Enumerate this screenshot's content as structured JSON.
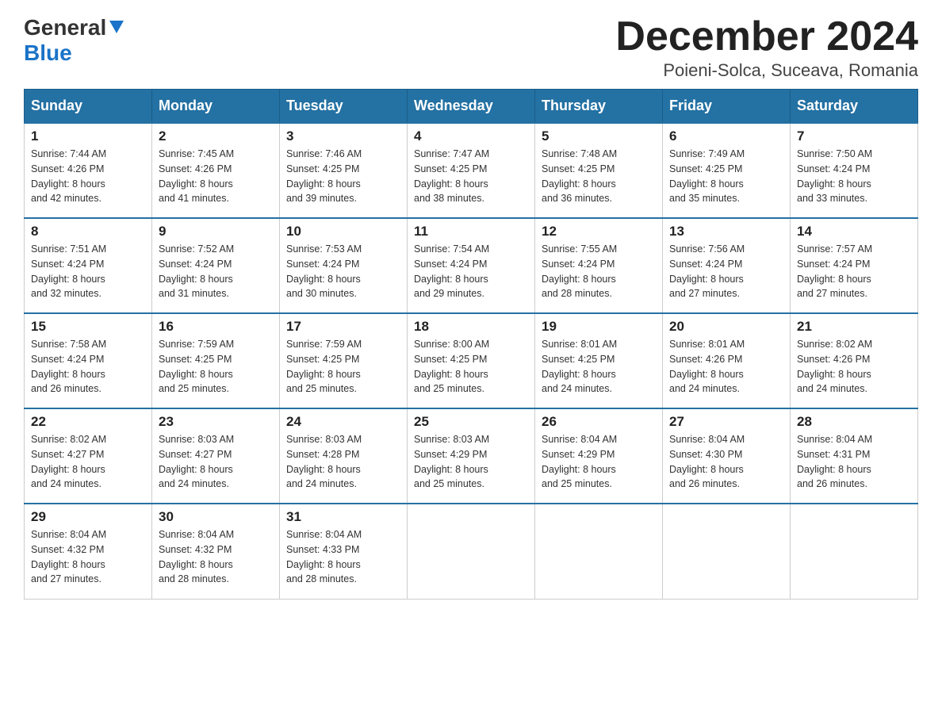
{
  "header": {
    "logo_line1": "General",
    "logo_line2": "Blue",
    "month_title": "December 2024",
    "location": "Poieni-Solca, Suceava, Romania"
  },
  "weekdays": [
    "Sunday",
    "Monday",
    "Tuesday",
    "Wednesday",
    "Thursday",
    "Friday",
    "Saturday"
  ],
  "weeks": [
    [
      {
        "day": "1",
        "sunrise": "7:44 AM",
        "sunset": "4:26 PM",
        "daylight": "8 hours and 42 minutes."
      },
      {
        "day": "2",
        "sunrise": "7:45 AM",
        "sunset": "4:26 PM",
        "daylight": "8 hours and 41 minutes."
      },
      {
        "day": "3",
        "sunrise": "7:46 AM",
        "sunset": "4:25 PM",
        "daylight": "8 hours and 39 minutes."
      },
      {
        "day": "4",
        "sunrise": "7:47 AM",
        "sunset": "4:25 PM",
        "daylight": "8 hours and 38 minutes."
      },
      {
        "day": "5",
        "sunrise": "7:48 AM",
        "sunset": "4:25 PM",
        "daylight": "8 hours and 36 minutes."
      },
      {
        "day": "6",
        "sunrise": "7:49 AM",
        "sunset": "4:25 PM",
        "daylight": "8 hours and 35 minutes."
      },
      {
        "day": "7",
        "sunrise": "7:50 AM",
        "sunset": "4:24 PM",
        "daylight": "8 hours and 33 minutes."
      }
    ],
    [
      {
        "day": "8",
        "sunrise": "7:51 AM",
        "sunset": "4:24 PM",
        "daylight": "8 hours and 32 minutes."
      },
      {
        "day": "9",
        "sunrise": "7:52 AM",
        "sunset": "4:24 PM",
        "daylight": "8 hours and 31 minutes."
      },
      {
        "day": "10",
        "sunrise": "7:53 AM",
        "sunset": "4:24 PM",
        "daylight": "8 hours and 30 minutes."
      },
      {
        "day": "11",
        "sunrise": "7:54 AM",
        "sunset": "4:24 PM",
        "daylight": "8 hours and 29 minutes."
      },
      {
        "day": "12",
        "sunrise": "7:55 AM",
        "sunset": "4:24 PM",
        "daylight": "8 hours and 28 minutes."
      },
      {
        "day": "13",
        "sunrise": "7:56 AM",
        "sunset": "4:24 PM",
        "daylight": "8 hours and 27 minutes."
      },
      {
        "day": "14",
        "sunrise": "7:57 AM",
        "sunset": "4:24 PM",
        "daylight": "8 hours and 27 minutes."
      }
    ],
    [
      {
        "day": "15",
        "sunrise": "7:58 AM",
        "sunset": "4:24 PM",
        "daylight": "8 hours and 26 minutes."
      },
      {
        "day": "16",
        "sunrise": "7:59 AM",
        "sunset": "4:25 PM",
        "daylight": "8 hours and 25 minutes."
      },
      {
        "day": "17",
        "sunrise": "7:59 AM",
        "sunset": "4:25 PM",
        "daylight": "8 hours and 25 minutes."
      },
      {
        "day": "18",
        "sunrise": "8:00 AM",
        "sunset": "4:25 PM",
        "daylight": "8 hours and 25 minutes."
      },
      {
        "day": "19",
        "sunrise": "8:01 AM",
        "sunset": "4:25 PM",
        "daylight": "8 hours and 24 minutes."
      },
      {
        "day": "20",
        "sunrise": "8:01 AM",
        "sunset": "4:26 PM",
        "daylight": "8 hours and 24 minutes."
      },
      {
        "day": "21",
        "sunrise": "8:02 AM",
        "sunset": "4:26 PM",
        "daylight": "8 hours and 24 minutes."
      }
    ],
    [
      {
        "day": "22",
        "sunrise": "8:02 AM",
        "sunset": "4:27 PM",
        "daylight": "8 hours and 24 minutes."
      },
      {
        "day": "23",
        "sunrise": "8:03 AM",
        "sunset": "4:27 PM",
        "daylight": "8 hours and 24 minutes."
      },
      {
        "day": "24",
        "sunrise": "8:03 AM",
        "sunset": "4:28 PM",
        "daylight": "8 hours and 24 minutes."
      },
      {
        "day": "25",
        "sunrise": "8:03 AM",
        "sunset": "4:29 PM",
        "daylight": "8 hours and 25 minutes."
      },
      {
        "day": "26",
        "sunrise": "8:04 AM",
        "sunset": "4:29 PM",
        "daylight": "8 hours and 25 minutes."
      },
      {
        "day": "27",
        "sunrise": "8:04 AM",
        "sunset": "4:30 PM",
        "daylight": "8 hours and 26 minutes."
      },
      {
        "day": "28",
        "sunrise": "8:04 AM",
        "sunset": "4:31 PM",
        "daylight": "8 hours and 26 minutes."
      }
    ],
    [
      {
        "day": "29",
        "sunrise": "8:04 AM",
        "sunset": "4:32 PM",
        "daylight": "8 hours and 27 minutes."
      },
      {
        "day": "30",
        "sunrise": "8:04 AM",
        "sunset": "4:32 PM",
        "daylight": "8 hours and 28 minutes."
      },
      {
        "day": "31",
        "sunrise": "8:04 AM",
        "sunset": "4:33 PM",
        "daylight": "8 hours and 28 minutes."
      },
      null,
      null,
      null,
      null
    ]
  ],
  "labels": {
    "sunrise": "Sunrise:",
    "sunset": "Sunset:",
    "daylight": "Daylight:"
  }
}
